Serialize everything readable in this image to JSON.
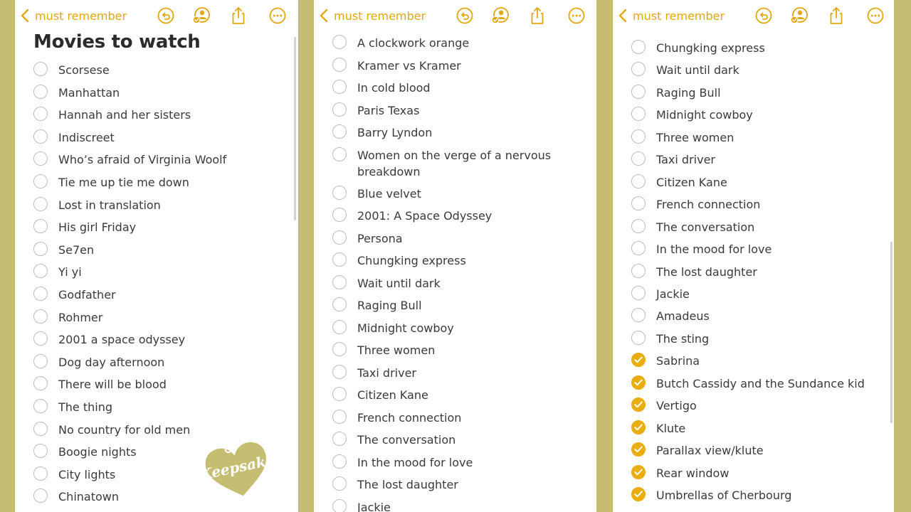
{
  "panels": [
    {
      "back_label": "must remember",
      "title": "Movies to watch",
      "items": [
        {
          "text": "Scorsese",
          "checked": false
        },
        {
          "text": "Manhattan",
          "checked": false
        },
        {
          "text": "Hannah and her sisters",
          "checked": false
        },
        {
          "text": "Indiscreet",
          "checked": false
        },
        {
          "text": "Who’s afraid of Virginia Woolf",
          "checked": false
        },
        {
          "text": "Tie me up tie me down",
          "checked": false
        },
        {
          "text": "Lost in translation",
          "checked": false
        },
        {
          "text": "His girl Friday",
          "checked": false
        },
        {
          "text": "Se7en",
          "checked": false
        },
        {
          "text": "Yi yi",
          "checked": false
        },
        {
          "text": "Godfather",
          "checked": false
        },
        {
          "text": "Rohmer",
          "checked": false
        },
        {
          "text": "2001 a space odyssey",
          "checked": false
        },
        {
          "text": "Dog day afternoon",
          "checked": false
        },
        {
          "text": "There will be blood",
          "checked": false
        },
        {
          "text": "The thing",
          "checked": false
        },
        {
          "text": "No country for old men",
          "checked": false
        },
        {
          "text": "Boogie nights",
          "checked": false
        },
        {
          "text": "City lights",
          "checked": false
        },
        {
          "text": "Chinatown",
          "checked": false
        }
      ],
      "sticker_text": "Keepsake"
    },
    {
      "back_label": "must remember",
      "items": [
        {
          "text": "A clockwork orange",
          "checked": false
        },
        {
          "text": "Kramer vs Kramer",
          "checked": false
        },
        {
          "text": "In cold blood",
          "checked": false
        },
        {
          "text": "Paris Texas",
          "checked": false
        },
        {
          "text": "Barry Lyndon",
          "checked": false
        },
        {
          "text": "Women on the verge of a nervous breakdown",
          "checked": false
        },
        {
          "text": "Blue velvet",
          "checked": false
        },
        {
          "text": "2001: A Space Odyssey",
          "checked": false
        },
        {
          "text": "Persona",
          "checked": false
        },
        {
          "text": "Chungking express",
          "checked": false
        },
        {
          "text": "Wait until dark",
          "checked": false
        },
        {
          "text": "Raging Bull",
          "checked": false
        },
        {
          "text": "Midnight cowboy",
          "checked": false
        },
        {
          "text": "Three women",
          "checked": false
        },
        {
          "text": "Taxi driver",
          "checked": false
        },
        {
          "text": "Citizen Kane",
          "checked": false
        },
        {
          "text": "French connection",
          "checked": false
        },
        {
          "text": "The conversation",
          "checked": false
        },
        {
          "text": "In the mood for love",
          "checked": false
        },
        {
          "text": "The lost daughter",
          "checked": false
        },
        {
          "text": "Jackie",
          "checked": false
        }
      ]
    },
    {
      "back_label": "must remember",
      "items": [
        {
          "text": "Chungking express",
          "checked": false
        },
        {
          "text": "Wait until dark",
          "checked": false
        },
        {
          "text": "Raging Bull",
          "checked": false
        },
        {
          "text": "Midnight cowboy",
          "checked": false
        },
        {
          "text": "Three women",
          "checked": false
        },
        {
          "text": "Taxi driver",
          "checked": false
        },
        {
          "text": "Citizen Kane",
          "checked": false
        },
        {
          "text": "French connection",
          "checked": false
        },
        {
          "text": "The conversation",
          "checked": false
        },
        {
          "text": "In the mood for love",
          "checked": false
        },
        {
          "text": "The lost daughter",
          "checked": false
        },
        {
          "text": "Jackie",
          "checked": false
        },
        {
          "text": "Amadeus",
          "checked": false
        },
        {
          "text": "The sting",
          "checked": false
        },
        {
          "text": "Sabrina",
          "checked": true
        },
        {
          "text": "Butch Cassidy and the Sundance kid",
          "checked": true
        },
        {
          "text": "Vertigo",
          "checked": true
        },
        {
          "text": "Klute",
          "checked": true
        },
        {
          "text": "Parallax view/klute",
          "checked": true
        },
        {
          "text": "Rear window",
          "checked": true
        },
        {
          "text": "Umbrellas of Cherbourg",
          "checked": true
        }
      ]
    }
  ],
  "icons": {
    "back": "chevron-left-icon",
    "undo": "undo-icon",
    "collaborate": "share-person-icon",
    "share": "share-icon",
    "more": "more-icon"
  },
  "colors": {
    "accent": "#e3a70f",
    "check_fill": "#e9ad0c",
    "background": "#c5bd71"
  }
}
